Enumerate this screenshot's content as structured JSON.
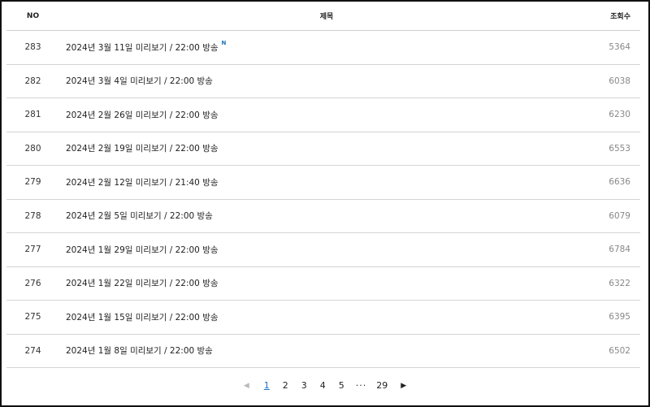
{
  "header": {
    "no": "NO",
    "title": "제목",
    "views": "조회수"
  },
  "rows": [
    {
      "no": "283",
      "title": "2024년 3월 11일 미리보기 / 22:00 방송",
      "new": "N",
      "views": "5364"
    },
    {
      "no": "282",
      "title": "2024년 3월 4일 미리보기 / 22:00 방송",
      "views": "6038"
    },
    {
      "no": "281",
      "title": "2024년 2월 26일 미리보기 / 22:00 방송",
      "views": "6230"
    },
    {
      "no": "280",
      "title": "2024년 2월 19일 미리보기 / 22:00 방송",
      "views": "6553"
    },
    {
      "no": "279",
      "title": "2024년 2월 12일 미리보기 / 21:40 방송",
      "views": "6636"
    },
    {
      "no": "278",
      "title": "2024년 2월 5일 미리보기 / 22:00 방송",
      "views": "6079"
    },
    {
      "no": "277",
      "title": "2024년 1월 29일 미리보기 / 22:00 방송",
      "views": "6784"
    },
    {
      "no": "276",
      "title": "2024년 1월 22일 미리보기 / 22:00 방송",
      "views": "6322"
    },
    {
      "no": "275",
      "title": "2024년 1월 15일 미리보기 / 22:00 방송",
      "views": "6395"
    },
    {
      "no": "274",
      "title": "2024년 1월 8일 미리보기 / 22:00 방송",
      "views": "6502"
    }
  ],
  "pagination": {
    "prev_icon": "◀",
    "next_icon": "▶",
    "pages": [
      "1",
      "2",
      "3",
      "4",
      "5"
    ],
    "ellipsis": "···",
    "last": "29",
    "current": "1",
    "active_color": "#1e73be"
  },
  "icons": {
    "prev": "chevron-left-icon",
    "next": "chevron-right-icon"
  }
}
